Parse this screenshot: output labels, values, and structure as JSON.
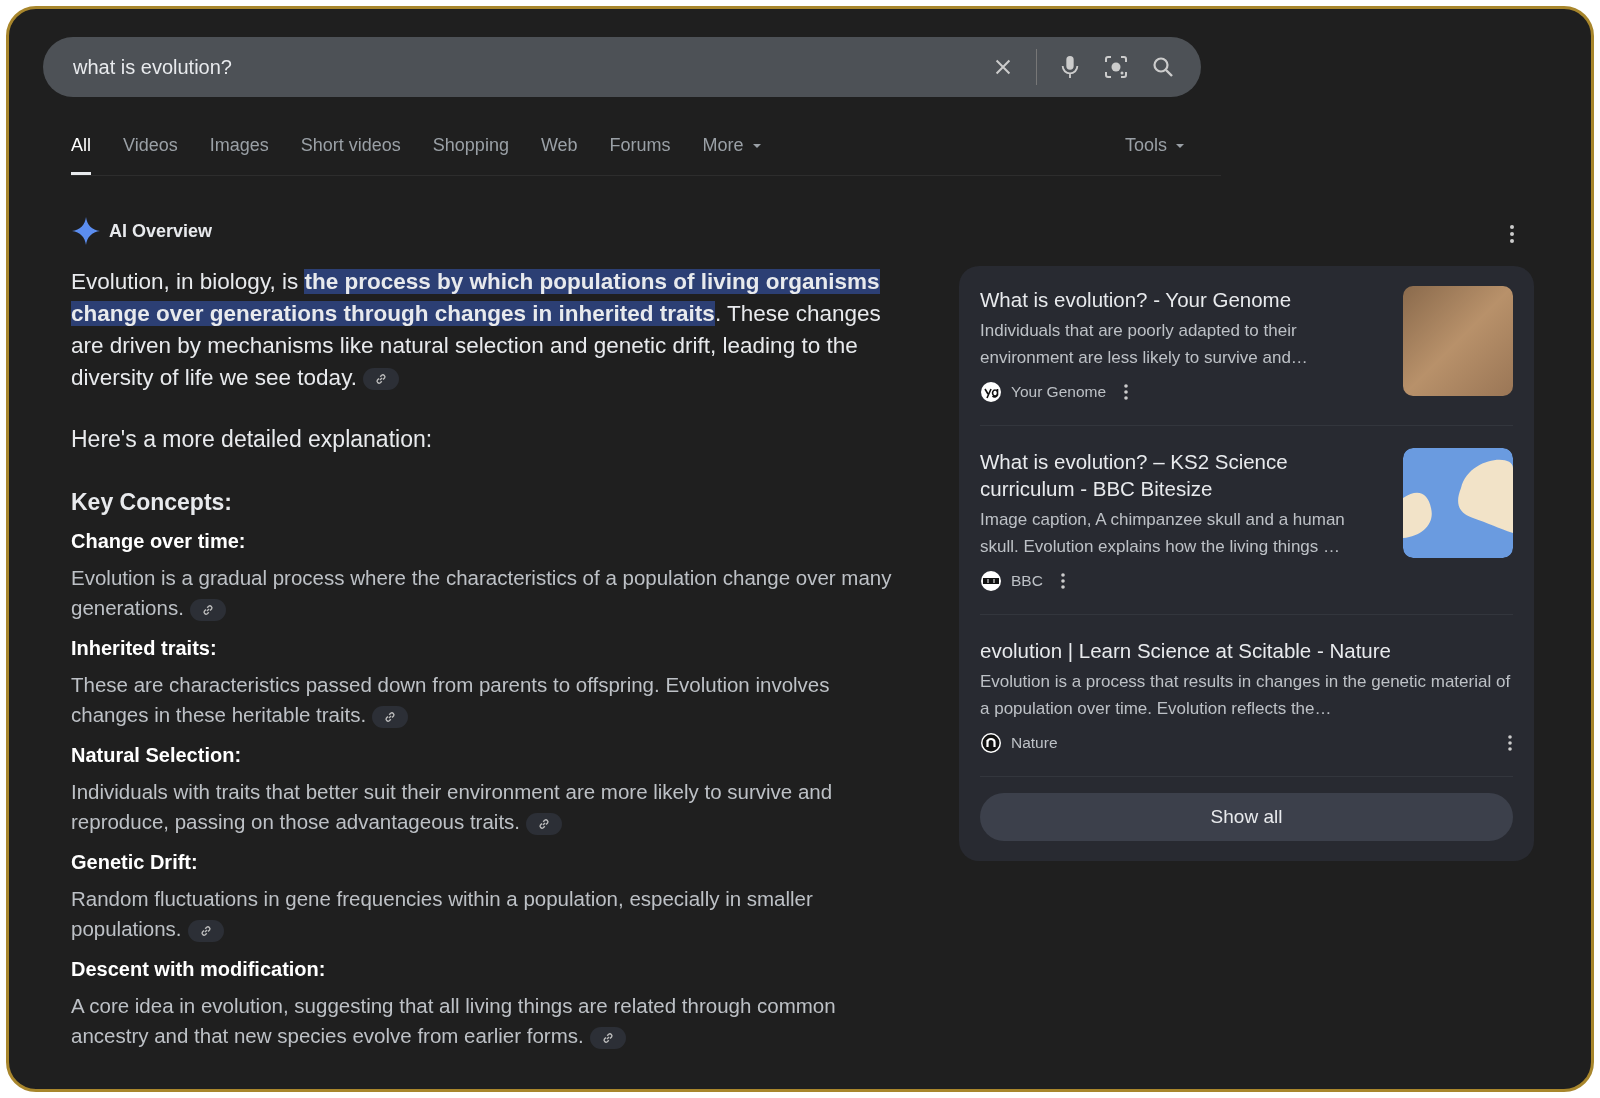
{
  "search": {
    "value": "what is evolution?"
  },
  "tabs": [
    {
      "label": "All",
      "selected": true,
      "dropdown": false
    },
    {
      "label": "Videos",
      "selected": false,
      "dropdown": false
    },
    {
      "label": "Images",
      "selected": false,
      "dropdown": false
    },
    {
      "label": "Short videos",
      "selected": false,
      "dropdown": false
    },
    {
      "label": "Shopping",
      "selected": false,
      "dropdown": false
    },
    {
      "label": "Web",
      "selected": false,
      "dropdown": false
    },
    {
      "label": "Forums",
      "selected": false,
      "dropdown": false
    },
    {
      "label": "More",
      "selected": false,
      "dropdown": true
    }
  ],
  "tools": {
    "label": "Tools"
  },
  "overview": {
    "title": "AI Overview",
    "lead": [
      {
        "text": "Evolution, in biology, is ",
        "highlighted": false
      },
      {
        "text": "the process by which populations of living organisms change over generations through changes in inherited traits",
        "highlighted": true
      },
      {
        "text": ". These changes are driven by mechanisms like natural selection and genetic drift, leading to the diversity of life we see today.",
        "highlighted": false
      }
    ],
    "detail_intro": "Here's a more detailed explanation:",
    "heading": "Key Concepts:",
    "concepts": [
      {
        "title": "Change over time:",
        "text": "Evolution is a gradual process where the characteristics of a population change over many generations."
      },
      {
        "title": "Inherited traits:",
        "text": "These are characteristics passed down from parents to offspring. Evolution involves changes in these heritable traits."
      },
      {
        "title": "Natural Selection:",
        "text": "Individuals with traits that better suit their environment are more likely to survive and reproduce, passing on those advantageous traits."
      },
      {
        "title": "Genetic Drift:",
        "text": "Random fluctuations in gene frequencies within a population, especially in smaller populations."
      },
      {
        "title": "Descent with modification:",
        "text": "A core idea in evolution, suggesting that all living things are related through common ancestry and that new species evolve from earlier forms."
      }
    ]
  },
  "sources": [
    {
      "title": "What is evolution? - Your Genome",
      "snippet": "Individuals that are poorly adapted to their environment are less likely to survive and…",
      "site": "Your Genome",
      "logo": {
        "kind": "yg"
      },
      "kind": "fossil"
    },
    {
      "title": "What is evolution? – KS2 Science curriculum - BBC Bitesize",
      "snippet": "Image caption, A chimpanzee skull and a human skull. Evolution explains how the living things …",
      "site": "BBC",
      "logo": {
        "kind": "bbc"
      },
      "kind": "skulls"
    },
    {
      "title": "evolution | Learn Science at Scitable - Nature",
      "snippet": "Evolution is a process that results in changes in the genetic material of a population over time. Evolution reflects the…",
      "site": "Nature",
      "logo": {
        "kind": "n"
      },
      "kind": "plain"
    }
  ],
  "show_all": "Show all"
}
